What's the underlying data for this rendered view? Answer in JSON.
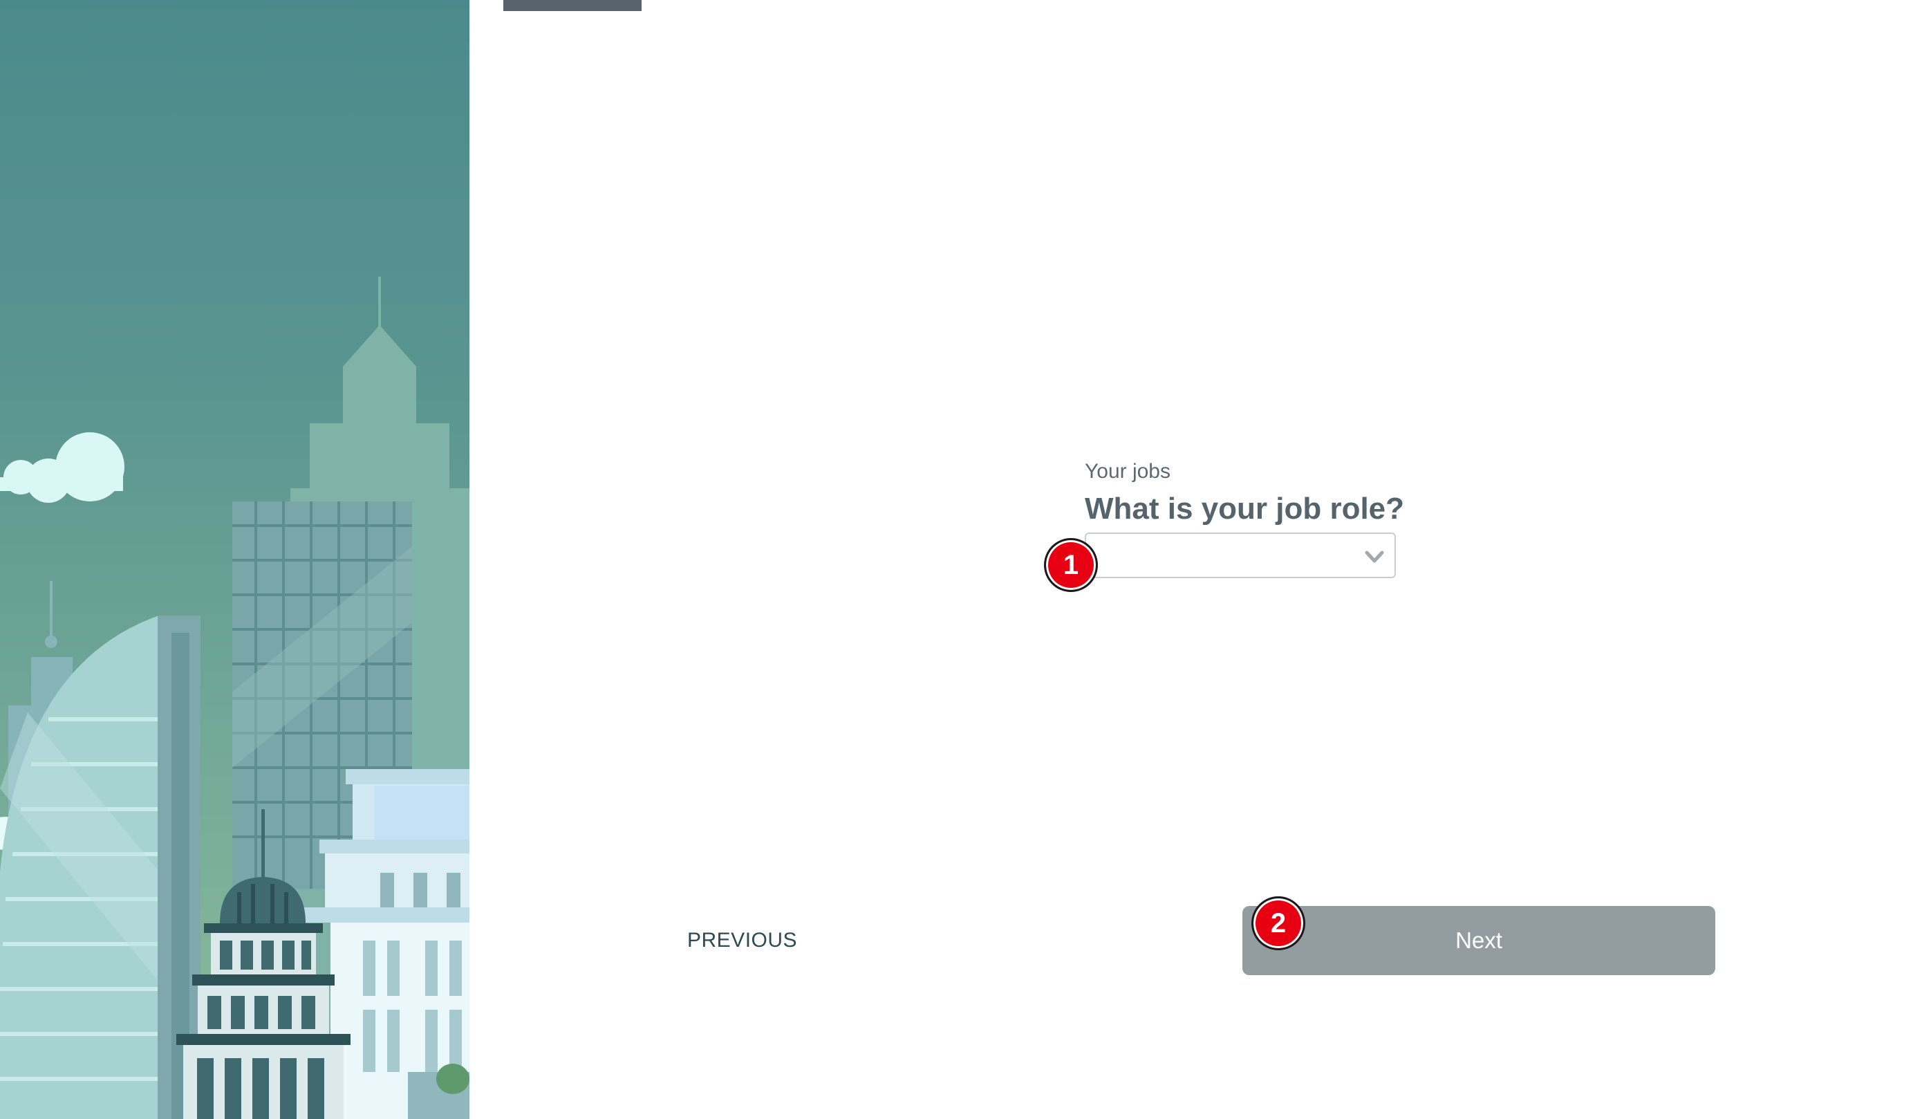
{
  "progress": {
    "fraction": 0.1
  },
  "question": {
    "section_label": "Your jobs",
    "title": "What is your job role?",
    "select_value": ""
  },
  "badges": {
    "first": "1",
    "second": "2"
  },
  "nav": {
    "previous_label": "PREVIOUS",
    "next_label": "Next"
  },
  "colors": {
    "accent": "#56636b",
    "next_button": "#929ca1",
    "badge": "#e60012"
  },
  "icons": {
    "select_chevron": "chevron-down-icon"
  }
}
